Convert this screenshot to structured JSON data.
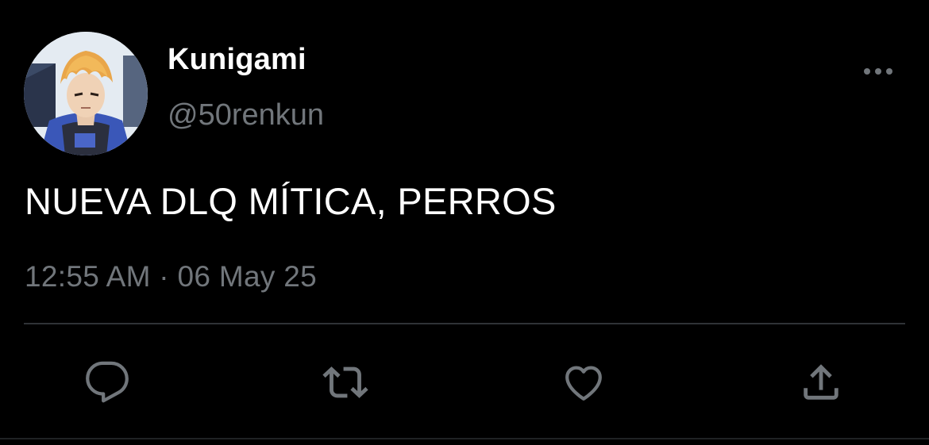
{
  "tweet": {
    "author": {
      "display_name": "Kunigami",
      "handle": "@50renkun",
      "avatar_icon": "anime-avatar"
    },
    "text": "NUEVA DLQ MÍTICA, PERROS",
    "meta": "12:55 AM · 06 May 25"
  },
  "actions": {
    "reply_icon": "reply-icon",
    "retweet_icon": "retweet-icon",
    "like_icon": "heart-icon",
    "share_icon": "share-icon"
  },
  "colors": {
    "background": "#000000",
    "primary_text": "#ffffff",
    "secondary_text": "#71767b",
    "divider": "#2f3336"
  }
}
